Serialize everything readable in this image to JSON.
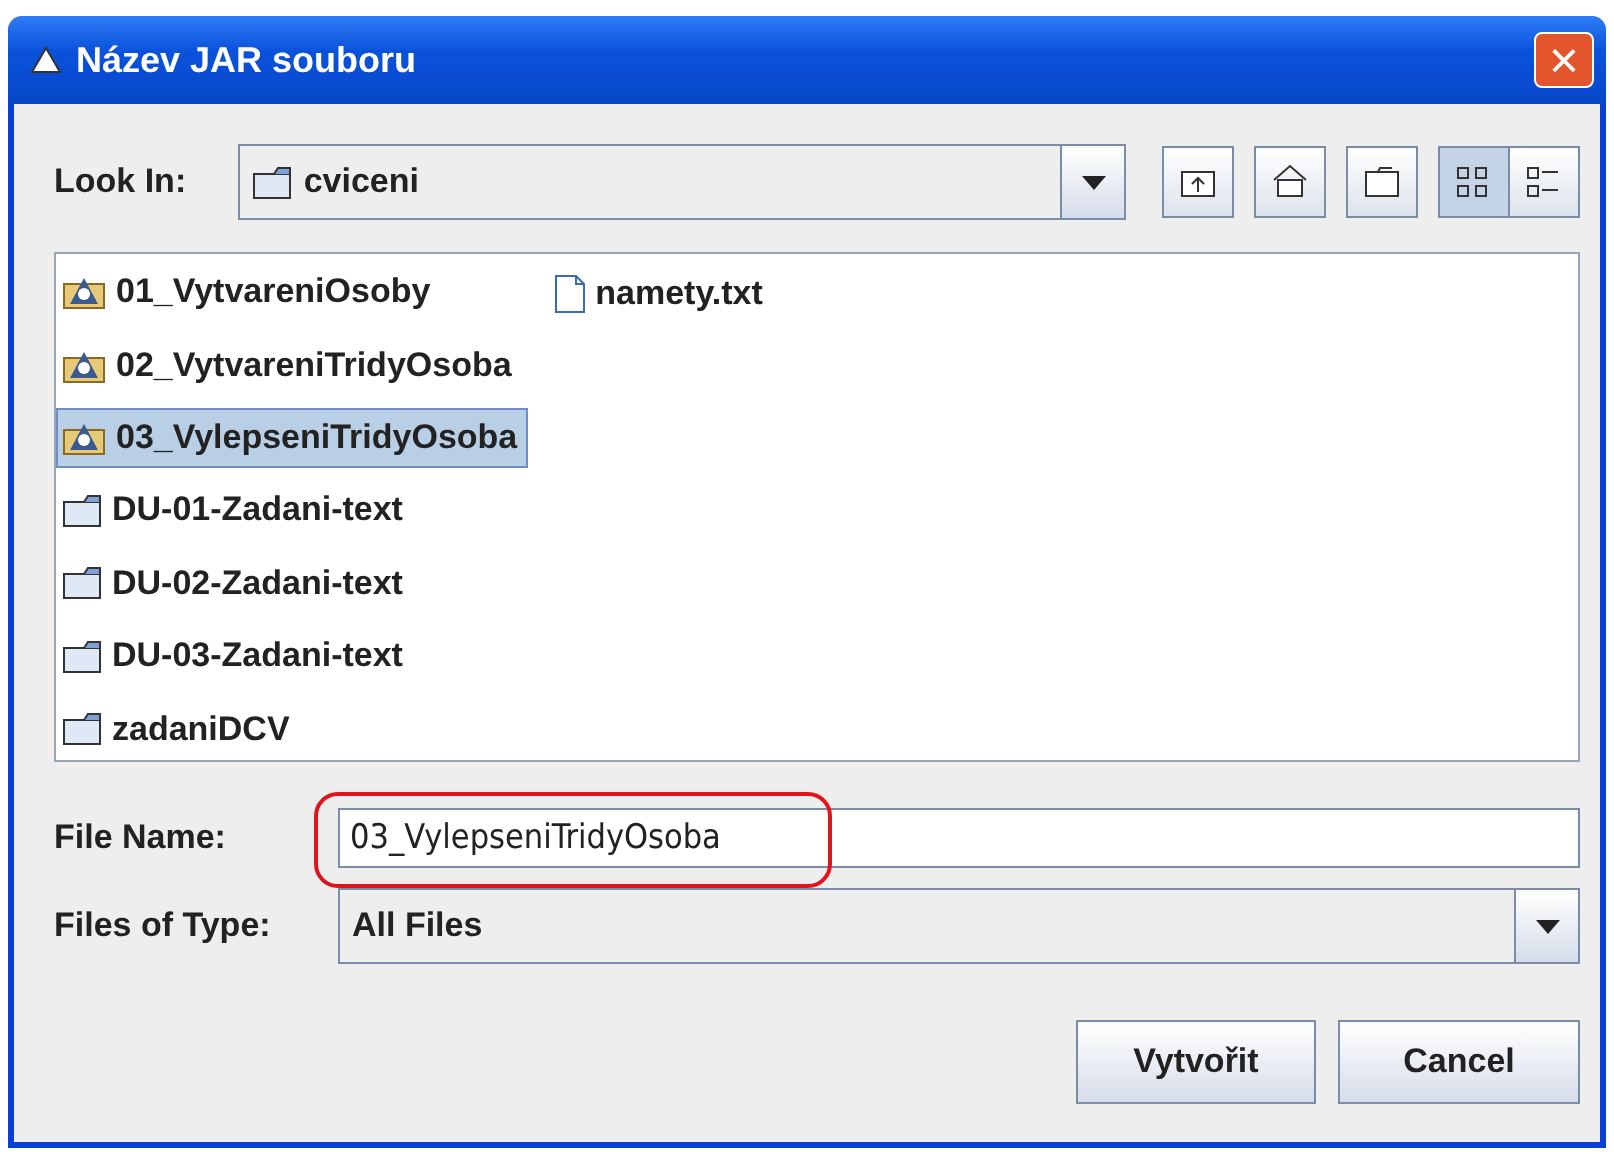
{
  "window": {
    "title": "Název JAR souboru",
    "close": "×"
  },
  "look_in": {
    "label": "Look In:",
    "value": "cviceni"
  },
  "toolbar": [
    {
      "kind": "up",
      "selected": false
    },
    {
      "kind": "home",
      "selected": false
    },
    {
      "kind": "newfolder",
      "selected": false
    },
    {
      "kind": "list",
      "selected": true
    },
    {
      "kind": "details",
      "selected": false
    }
  ],
  "files": [
    {
      "name": "01_VytvareniOsoby",
      "kind": "jar",
      "selected": false
    },
    {
      "name": "02_VytvareniTridyOsoba",
      "kind": "jar",
      "selected": false
    },
    {
      "name": "03_VylepseniTridyOsoba",
      "kind": "jar",
      "selected": true
    },
    {
      "name": "DU-01-Zadani-text",
      "kind": "folder",
      "selected": false
    },
    {
      "name": "DU-02-Zadani-text",
      "kind": "folder",
      "selected": false
    },
    {
      "name": "DU-03-Zadani-text",
      "kind": "folder",
      "selected": false
    },
    {
      "name": "zadaniDCV",
      "kind": "folder",
      "selected": false
    },
    {
      "name": "namety.txt",
      "kind": "file",
      "selected": false
    }
  ],
  "file_name": {
    "label": "File Name:",
    "value": "03_VylepseniTridyOsoba",
    "highlighted": true
  },
  "file_type": {
    "label": "Files of Type:",
    "value": "All Files"
  },
  "buttons": [
    "Vytvořit",
    "Cancel"
  ]
}
